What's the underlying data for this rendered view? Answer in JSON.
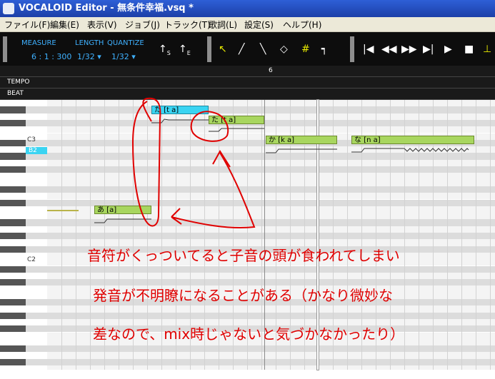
{
  "window": {
    "title": "VOCALOID Editor - 無条件幸福.vsq *"
  },
  "menu": [
    "ファイル(F)",
    "編集(E)",
    "表示(V)",
    "ジョブ(J)",
    "トラック(T)",
    "歌詞(L)",
    "設定(S)",
    "ヘルプ(H)"
  ],
  "toolbar": {
    "measure_label": "MEASURE",
    "measure_value": "6 : 1 : 300",
    "length_label": "LENGTH",
    "length_value": "1/32 ▾",
    "quantize_label": "QUANTIZE",
    "quantize_value": "1/32 ▾",
    "tools": [
      "↖",
      "╱",
      "╲",
      "◇",
      "#",
      "┑"
    ],
    "transport": [
      "|◀",
      "◀◀",
      "▶▶",
      "▶|",
      "▶",
      "■",
      "⊥"
    ]
  },
  "ruler": {
    "measure_number": "6",
    "tempo_label": "TEMPO",
    "beat_label": "BEAT"
  },
  "keyboard": {
    "c3": "C3",
    "b2": "B2",
    "c2": "C2"
  },
  "notes": [
    {
      "lyric": "た [t a]",
      "selected": true
    },
    {
      "lyric": "た [t a]",
      "selected": false
    },
    {
      "lyric": "か [k a]",
      "selected": false
    },
    {
      "lyric": "な [n a]",
      "selected": false
    },
    {
      "lyric": "あ [a]",
      "selected": false
    }
  ],
  "annotation": {
    "line1": "音符がくっついてると子音の頭が食われてしまい",
    "line2": "発音が不明瞭になることがある（かなり微妙な",
    "line3": "差なので、mix時じゃないと気づかなかったり）"
  },
  "colors": {
    "annotation": "#e00000",
    "note": "#a8d65f",
    "note_selected": "#3ad4f2",
    "toolbar_text": "#3fb1ff"
  }
}
